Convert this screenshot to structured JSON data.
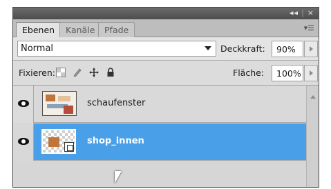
{
  "panel": {
    "controls": {
      "collapse": "◂◂",
      "close": "×"
    },
    "tabs": [
      {
        "label": "Ebenen",
        "active": true
      },
      {
        "label": "Kanäle",
        "active": false
      },
      {
        "label": "Pfade",
        "active": false
      }
    ],
    "menu_icon": "panel-menu-icon"
  },
  "blend": {
    "mode": "Normal",
    "opacity_label": "Deckkraft:",
    "opacity_value": "90%"
  },
  "lock": {
    "label": "Fixieren:",
    "fill_label": "Fläche:",
    "fill_value": "100%"
  },
  "layers": [
    {
      "name": "schaufenster",
      "visible": true,
      "selected": false
    },
    {
      "name": "shop_innen",
      "visible": true,
      "selected": true
    }
  ],
  "colors": {
    "selection": "#4aa0e8",
    "panel_bg": "#d6d6d6",
    "titlebar": "#555555"
  }
}
